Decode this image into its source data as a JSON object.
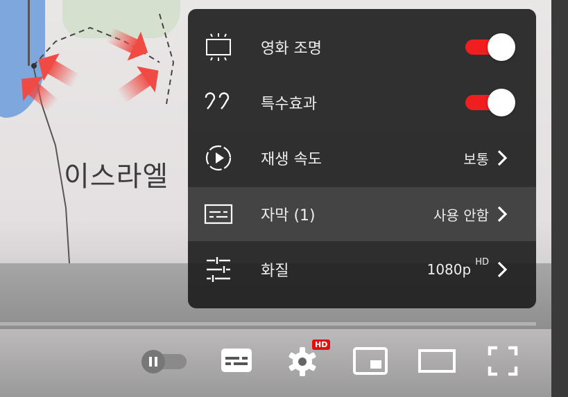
{
  "video": {
    "map_label": "이스라엘"
  },
  "settings_menu": {
    "items": [
      {
        "label": "영화 조명",
        "icon": "ambient-light-icon",
        "type": "toggle",
        "on": true
      },
      {
        "label": "특수효과",
        "icon": "stable-volume-icon",
        "type": "toggle",
        "on": true
      },
      {
        "label": "재생 속도",
        "icon": "playback-speed-icon",
        "type": "submenu",
        "value": "보통"
      },
      {
        "label": "자막 (1)",
        "icon": "subtitles-icon",
        "type": "submenu",
        "value": "사용 안함",
        "highlighted": true
      },
      {
        "label": "화질",
        "icon": "quality-icon",
        "type": "submenu",
        "value": "1080p",
        "value_suffix": "HD"
      }
    ]
  },
  "controls": {
    "autoplay_toggle": "off",
    "settings_badge": "HD",
    "buttons": [
      "autoplay-toggle",
      "subtitles-button",
      "settings-button",
      "miniplayer-button",
      "theater-mode-button",
      "fullscreen-button"
    ]
  },
  "colors": {
    "toggle_on": "#f01e1e",
    "badge": "#e01010",
    "menu_bg": "#1c1c1c"
  }
}
